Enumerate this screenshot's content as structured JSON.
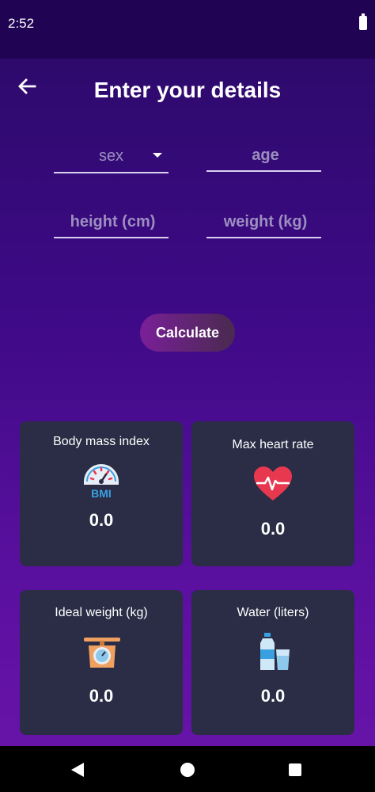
{
  "status_bar": {
    "time": "2:52"
  },
  "header": {
    "title": "Enter your details"
  },
  "form": {
    "sex_placeholder": "sex",
    "age_placeholder": "age",
    "height_placeholder": "height (cm)",
    "weight_placeholder": "weight (kg)",
    "calculate_label": "Calculate"
  },
  "cards": [
    {
      "title": "Body mass index",
      "value": "0.0",
      "icon": "bmi-gauge-icon",
      "icon_text": "BMI"
    },
    {
      "title": "Max heart rate",
      "value": "0.0",
      "icon": "heart-rate-icon"
    },
    {
      "title": "Ideal weight (kg)",
      "value": "0.0",
      "icon": "scale-icon"
    },
    {
      "title": "Water (liters)",
      "value": "0.0",
      "icon": "water-bottle-icon"
    }
  ],
  "colors": {
    "card_bg": "#2a2d45",
    "heart": "#e8384f",
    "gauge": "#3aa0e0",
    "scale": "#f0a060"
  }
}
